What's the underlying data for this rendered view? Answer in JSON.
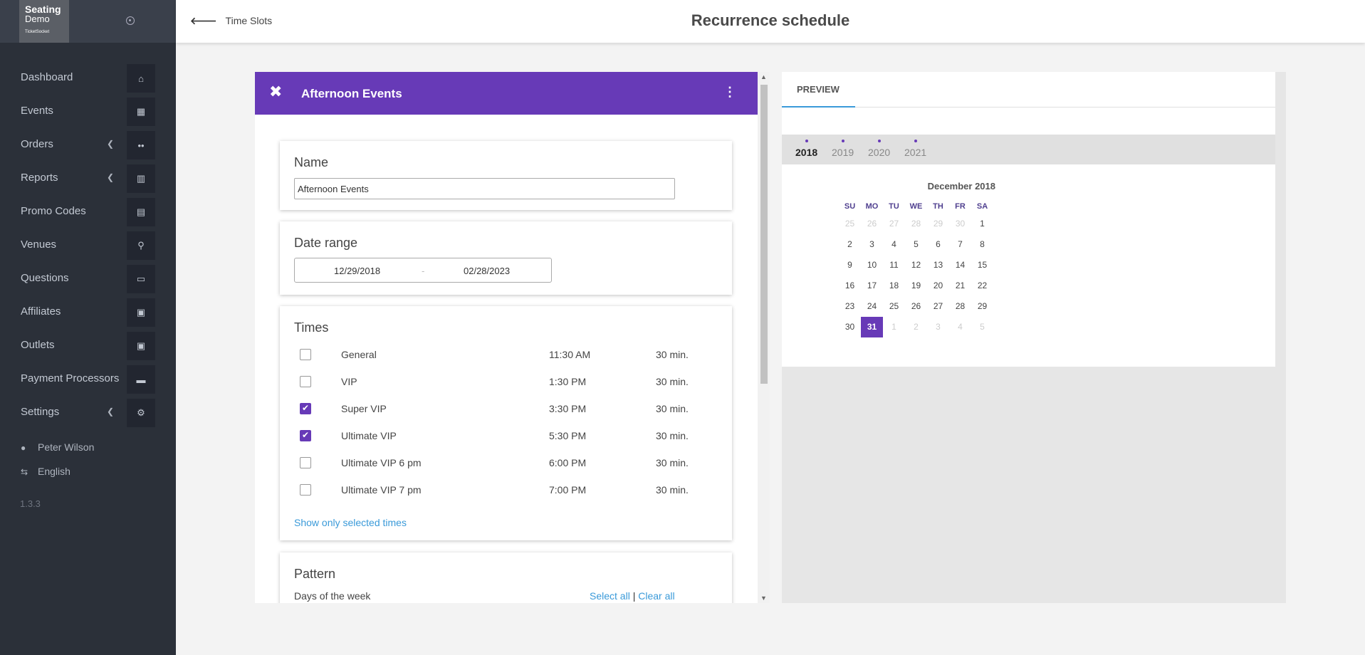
{
  "sidebar": {
    "logo": {
      "line1": "Seating",
      "line2": "Demo",
      "line3": "TicketSocket"
    },
    "items": [
      {
        "label": "Dashboard",
        "icon": "⌂",
        "chevron": false
      },
      {
        "label": "Events",
        "icon": "▦",
        "chevron": false
      },
      {
        "label": "Orders",
        "icon": "••",
        "chevron": true
      },
      {
        "label": "Reports",
        "icon": "▥",
        "chevron": true
      },
      {
        "label": "Promo Codes",
        "icon": "▤",
        "chevron": false
      },
      {
        "label": "Venues",
        "icon": "⚲",
        "chevron": false
      },
      {
        "label": "Questions",
        "icon": "▭",
        "chevron": false
      },
      {
        "label": "Affiliates",
        "icon": "▣",
        "chevron": false
      },
      {
        "label": "Outlets",
        "icon": "▣",
        "chevron": false
      },
      {
        "label": "Payment Processors",
        "icon": "▬",
        "chevron": false
      },
      {
        "label": "Settings",
        "icon": "⚙",
        "chevron": true
      }
    ],
    "user": "Peter Wilson",
    "language": "English",
    "version": "1.3.3"
  },
  "header": {
    "back_label": "Time Slots",
    "title": "Recurrence schedule"
  },
  "editor": {
    "title": "Afternoon Events",
    "name_card": {
      "heading": "Name",
      "value": "Afternoon Events"
    },
    "date_card": {
      "heading": "Date range",
      "start": "12/29/2018",
      "separator": "-",
      "end": "02/28/2023"
    },
    "times_card": {
      "heading": "Times",
      "rows": [
        {
          "name": "General",
          "time": "11:30 AM",
          "duration": "30 min.",
          "checked": false
        },
        {
          "name": "VIP",
          "time": "1:30 PM",
          "duration": "30 min.",
          "checked": false
        },
        {
          "name": "Super VIP",
          "time": "3:30 PM",
          "duration": "30 min.",
          "checked": true
        },
        {
          "name": "Ultimate VIP",
          "time": "5:30 PM",
          "duration": "30 min.",
          "checked": true
        },
        {
          "name": "Ultimate VIP 6 pm",
          "time": "6:00 PM",
          "duration": "30 min.",
          "checked": false
        },
        {
          "name": "Ultimate VIP 7 pm",
          "time": "7:00 PM",
          "duration": "30 min.",
          "checked": false
        }
      ],
      "show_selected_link": "Show only selected times"
    },
    "pattern_card": {
      "heading": "Pattern",
      "days_label": "Days of the week",
      "select_all": "Select all",
      "divider": "|",
      "clear_all": "Clear all"
    }
  },
  "preview": {
    "tab": "PREVIEW",
    "years": [
      "2018",
      "2019",
      "2020",
      "2021"
    ],
    "active_year": "2018",
    "month": "December 2018",
    "weekdays": [
      "SU",
      "MO",
      "TU",
      "WE",
      "TH",
      "FR",
      "SA"
    ],
    "weeks": [
      [
        "25",
        "26",
        "27",
        "28",
        "29",
        "30",
        "1"
      ],
      [
        "2",
        "3",
        "4",
        "5",
        "6",
        "7",
        "8"
      ],
      [
        "9",
        "10",
        "11",
        "12",
        "13",
        "14",
        "15"
      ],
      [
        "16",
        "17",
        "18",
        "19",
        "20",
        "21",
        "22"
      ],
      [
        "23",
        "24",
        "25",
        "26",
        "27",
        "28",
        "29"
      ],
      [
        "30",
        "31",
        "1",
        "2",
        "3",
        "4",
        "5"
      ]
    ],
    "selected_day": "31"
  },
  "colors": {
    "accent": "#673ab7",
    "link": "#3a9ad9",
    "sidebar": "#2b3039"
  }
}
